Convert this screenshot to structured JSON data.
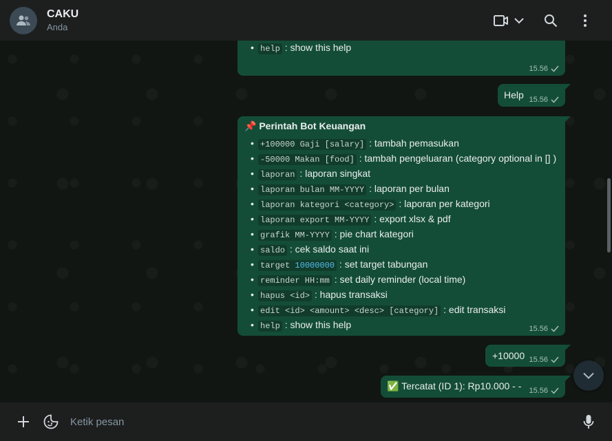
{
  "header": {
    "title": "CAKU",
    "subtitle": "Anda",
    "icons": {
      "avatar": "group-icon",
      "video": "video-call-icon",
      "dropdown": "chevron-down-icon",
      "search": "search-icon",
      "menu": "more-vertical-icon"
    }
  },
  "messages": {
    "top_partial": {
      "cmd": "help",
      "text": ": show this help",
      "time": "15.56"
    },
    "help": {
      "text": "Help",
      "time": "15.56"
    },
    "commands": {
      "title_emoji": "📌",
      "title": "Perintah Bot Keuangan",
      "time": "15.56",
      "items": [
        {
          "code": "+100000 Gaji [salary]",
          "text": ": tambah pemasukan"
        },
        {
          "code": "-50000 Makan [food]",
          "text": ": tambah pengeluaran (category optional in [] )"
        },
        {
          "code": "laporan",
          "text": ": laporan singkat"
        },
        {
          "code": "laporan bulan MM-YYYY",
          "text": ": laporan per bulan"
        },
        {
          "code": "laporan kategori <category>",
          "text": ": laporan per kategori"
        },
        {
          "code": "laporan export MM-YYYY",
          "text": ": export xlsx & pdf"
        },
        {
          "code": "grafik MM-YYYY",
          "text": ": pie chart kategori"
        },
        {
          "code": "saldo",
          "text": ": cek saldo saat ini"
        },
        {
          "code_prefix": "target ",
          "code_num": "10000000",
          "text": ": set target tabungan"
        },
        {
          "code": "reminder HH:mm",
          "text": ": set daily reminder (local time)"
        },
        {
          "code": "hapus <id>",
          "text": ": hapus transaksi"
        },
        {
          "code": "edit <id> <amount> <desc> [category]",
          "text": ": edit transaksi"
        },
        {
          "code": "help",
          "text": ": show this help"
        }
      ]
    },
    "amount": {
      "text": "+10000",
      "time": "15.56"
    },
    "recorded": {
      "emoji": "✅",
      "text": "Tercatat (ID 1): Rp10.000 - -",
      "time": "15.56"
    }
  },
  "composer": {
    "placeholder": "Ketik pesan",
    "icons": {
      "add": "plus-icon",
      "sticker": "sticker-icon",
      "mic": "microphone-icon"
    }
  },
  "scroll_button": {
    "icon": "chevron-down-icon"
  },
  "colors": {
    "outgoing_bubble": "#144d37",
    "header": "#1d1f1f",
    "read_tick": "#a7c1b4"
  }
}
